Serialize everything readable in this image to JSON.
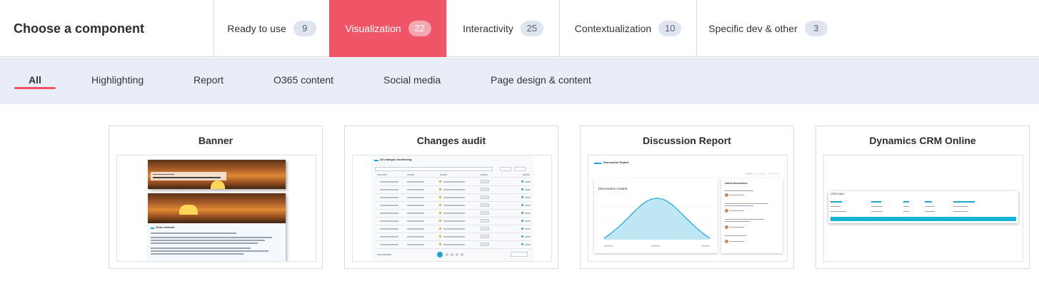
{
  "header": {
    "title": "Choose a component",
    "tabs": [
      {
        "label": "Ready to use",
        "count": "9",
        "active": false
      },
      {
        "label": "Visualization",
        "count": "22",
        "active": true
      },
      {
        "label": "Interactivity",
        "count": "25",
        "active": false
      },
      {
        "label": "Contextualization",
        "count": "10",
        "active": false
      },
      {
        "label": "Specific dev & other",
        "count": "3",
        "active": false
      }
    ]
  },
  "subnav": {
    "items": [
      {
        "label": "All",
        "active": true
      },
      {
        "label": "Highlighting",
        "active": false
      },
      {
        "label": "Report",
        "active": false
      },
      {
        "label": "O365 content",
        "active": false
      },
      {
        "label": "Social media",
        "active": false
      },
      {
        "label": "Page design & content",
        "active": false
      }
    ]
  },
  "cards": [
    {
      "title": "Banner",
      "thumb": {
        "heading": "Orion Intranet"
      }
    },
    {
      "title": "Changes audit",
      "thumb": {
        "heading": "All changes monitoring"
      }
    },
    {
      "title": "Discussion Report",
      "thumb": {
        "heading": "Discussion Report",
        "chart_title": "Discussions created",
        "side_title": "Latest discussions"
      }
    },
    {
      "title": "Dynamics CRM Online",
      "thumb": {
        "heading": "CRM Online"
      }
    }
  ],
  "colors": {
    "accent": "#ef5467",
    "badge": "#dfe5ef",
    "subnav_bg": "#e8edf7",
    "teal": "#1aa6d1"
  }
}
